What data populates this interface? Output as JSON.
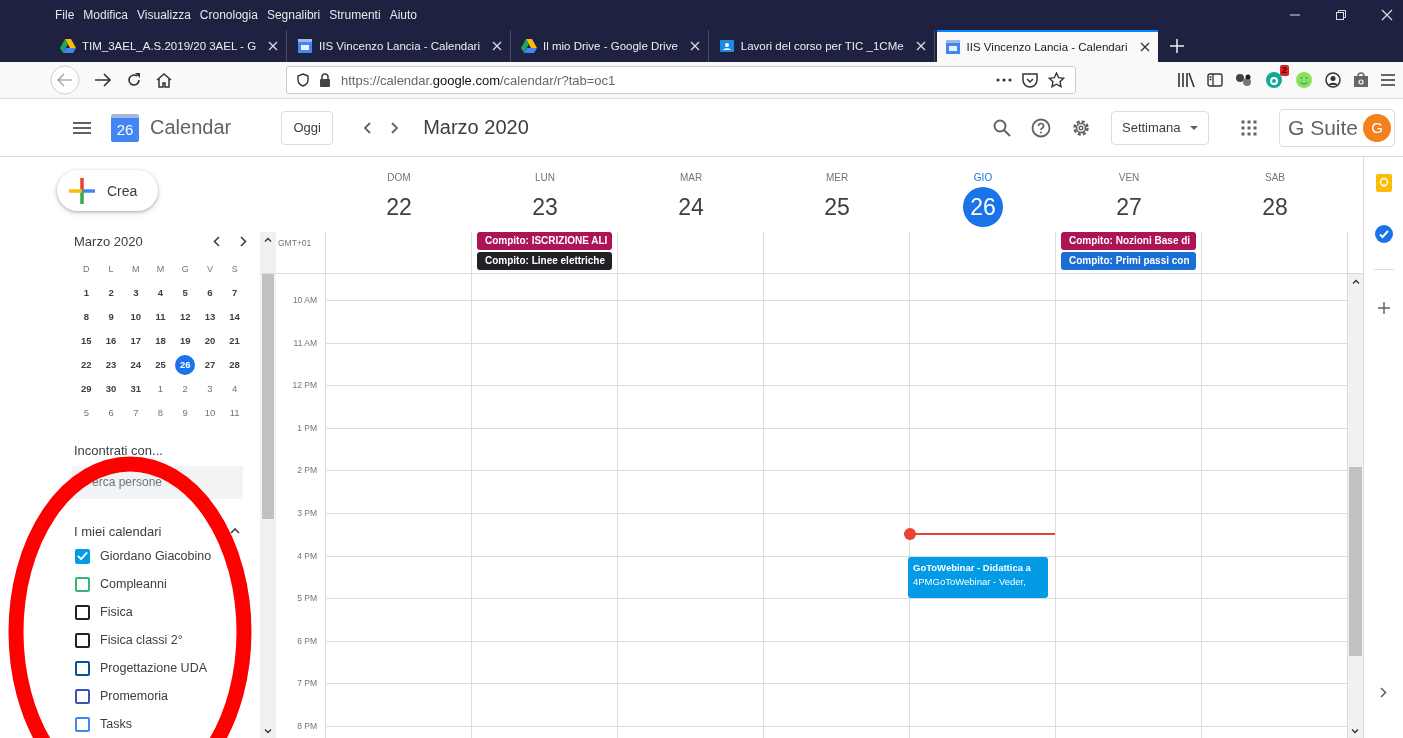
{
  "menu_bar": [
    "File",
    "Modifica",
    "Visualizza",
    "Cronologia",
    "Segnalibri",
    "Strumenti",
    "Aiuto"
  ],
  "browser_tabs": [
    {
      "label": "TIM_3AEL_A.S.2019/20 3AEL - G",
      "selected": false
    },
    {
      "label": "IIS Vincenzo Lancia - Calendari",
      "selected": false
    },
    {
      "label": "Il mio Drive - Google Drive",
      "selected": false
    },
    {
      "label": "Lavori del corso per TIC _1CMe",
      "selected": false
    },
    {
      "label": "IIS Vincenzo Lancia - Calendari",
      "selected": true
    }
  ],
  "address_bar": {
    "url": "https://calendar.**google.com**/calendar/r?tab=oc1"
  },
  "extension_badge": "2",
  "app_header": {
    "logo_number": "26",
    "app_name": "Calendar",
    "today_button": "Oggi",
    "period": "Marzo 2020",
    "view_selector": "Settimana",
    "suite_label": "G Suite",
    "avatar_letter": "G"
  },
  "create_button": "Crea",
  "mini_calendar": {
    "title": "Marzo 2020",
    "weekdays": [
      "D",
      "L",
      "M",
      "M",
      "G",
      "V",
      "S"
    ],
    "weeks": [
      [
        {
          "d": "1",
          "muted": false,
          "selected": false
        },
        {
          "d": "2",
          "muted": false,
          "selected": false
        },
        {
          "d": "3",
          "muted": false,
          "selected": false
        },
        {
          "d": "4",
          "muted": false,
          "selected": false
        },
        {
          "d": "5",
          "muted": false,
          "selected": false
        },
        {
          "d": "6",
          "muted": false,
          "selected": false
        },
        {
          "d": "7",
          "muted": false,
          "selected": false
        }
      ],
      [
        {
          "d": "8",
          "muted": false,
          "selected": false
        },
        {
          "d": "9",
          "muted": false,
          "selected": false
        },
        {
          "d": "10",
          "muted": false,
          "selected": false
        },
        {
          "d": "11",
          "muted": false,
          "selected": false
        },
        {
          "d": "12",
          "muted": false,
          "selected": false
        },
        {
          "d": "13",
          "muted": false,
          "selected": false
        },
        {
          "d": "14",
          "muted": false,
          "selected": false
        }
      ],
      [
        {
          "d": "15",
          "muted": false,
          "selected": false
        },
        {
          "d": "16",
          "muted": false,
          "selected": false
        },
        {
          "d": "17",
          "muted": false,
          "selected": false
        },
        {
          "d": "18",
          "muted": false,
          "selected": false
        },
        {
          "d": "19",
          "muted": false,
          "selected": false
        },
        {
          "d": "20",
          "muted": false,
          "selected": false
        },
        {
          "d": "21",
          "muted": false,
          "selected": false
        }
      ],
      [
        {
          "d": "22",
          "muted": false,
          "selected": false
        },
        {
          "d": "23",
          "muted": false,
          "selected": false
        },
        {
          "d": "24",
          "muted": false,
          "selected": false
        },
        {
          "d": "25",
          "muted": false,
          "selected": false
        },
        {
          "d": "26",
          "muted": false,
          "selected": true
        },
        {
          "d": "27",
          "muted": false,
          "selected": false
        },
        {
          "d": "28",
          "muted": false,
          "selected": false
        }
      ],
      [
        {
          "d": "29",
          "muted": false,
          "selected": false
        },
        {
          "d": "30",
          "muted": false,
          "selected": false
        },
        {
          "d": "31",
          "muted": false,
          "selected": false
        },
        {
          "d": "1",
          "muted": true,
          "selected": false
        },
        {
          "d": "2",
          "muted": true,
          "selected": false
        },
        {
          "d": "3",
          "muted": true,
          "selected": false
        },
        {
          "d": "4",
          "muted": true,
          "selected": false
        }
      ],
      [
        {
          "d": "5",
          "muted": true,
          "selected": false
        },
        {
          "d": "6",
          "muted": true,
          "selected": false
        },
        {
          "d": "7",
          "muted": true,
          "selected": false
        },
        {
          "d": "8",
          "muted": true,
          "selected": false
        },
        {
          "d": "9",
          "muted": true,
          "selected": false
        },
        {
          "d": "10",
          "muted": true,
          "selected": false
        },
        {
          "d": "11",
          "muted": true,
          "selected": false
        }
      ]
    ]
  },
  "meet_with": {
    "title": "Incontrati con...",
    "placeholder": "erca persone"
  },
  "my_calendars": {
    "title": "I miei calendari",
    "expanded": true,
    "items": [
      {
        "name": "Giordano Giacobino",
        "color": "#039be5",
        "checked": true
      },
      {
        "name": "Compleanni",
        "color": "#33b679",
        "checked": false
      },
      {
        "name": "Fisica",
        "color": "#202124",
        "checked": false
      },
      {
        "name": "Fisica classi 2°",
        "color": "#202124",
        "checked": false
      },
      {
        "name": "Progettazione UDA",
        "color": "#0b4ea2",
        "checked": false
      },
      {
        "name": "Promemoria",
        "color": "#3f51b5",
        "checked": false
      },
      {
        "name": "Tasks",
        "color": "#4285f4",
        "checked": false
      }
    ]
  },
  "timezone": "GMT+01",
  "days": [
    {
      "name": "DOM",
      "number": "22",
      "selected": false
    },
    {
      "name": "LUN",
      "number": "23",
      "selected": false,
      "all_day_events": [
        {
          "title": "Compito: ISCRIZIONE ALI",
          "color": "#ad1457"
        },
        {
          "title": "Compito: Linee elettriche",
          "color": "#202124"
        }
      ]
    },
    {
      "name": "MAR",
      "number": "24",
      "selected": false
    },
    {
      "name": "MER",
      "number": "25",
      "selected": false
    },
    {
      "name": "GIO",
      "number": "26",
      "selected": true,
      "now_marker": true,
      "timed_events": [
        {
          "title": "GoToWebinar - Didattica a",
          "details": "4PMGoToWebinar - Veder,",
          "color": "#039be5"
        }
      ]
    },
    {
      "name": "VEN",
      "number": "27",
      "selected": false,
      "all_day_events": [
        {
          "title": "Compito: Nozioni Base di",
          "color": "#ad1457"
        },
        {
          "title": "Compito: Primi passi con",
          "color": "#1a6fd4"
        }
      ]
    },
    {
      "name": "SAB",
      "number": "28",
      "selected": false
    }
  ],
  "hours": [
    "10 AM",
    "11 AM",
    "12 PM",
    "1 PM",
    "2 PM",
    "3 PM",
    "4 PM",
    "5 PM",
    "6 PM",
    "7 PM",
    "8 PM"
  ],
  "annotation": {
    "kind": "ellipse"
  }
}
